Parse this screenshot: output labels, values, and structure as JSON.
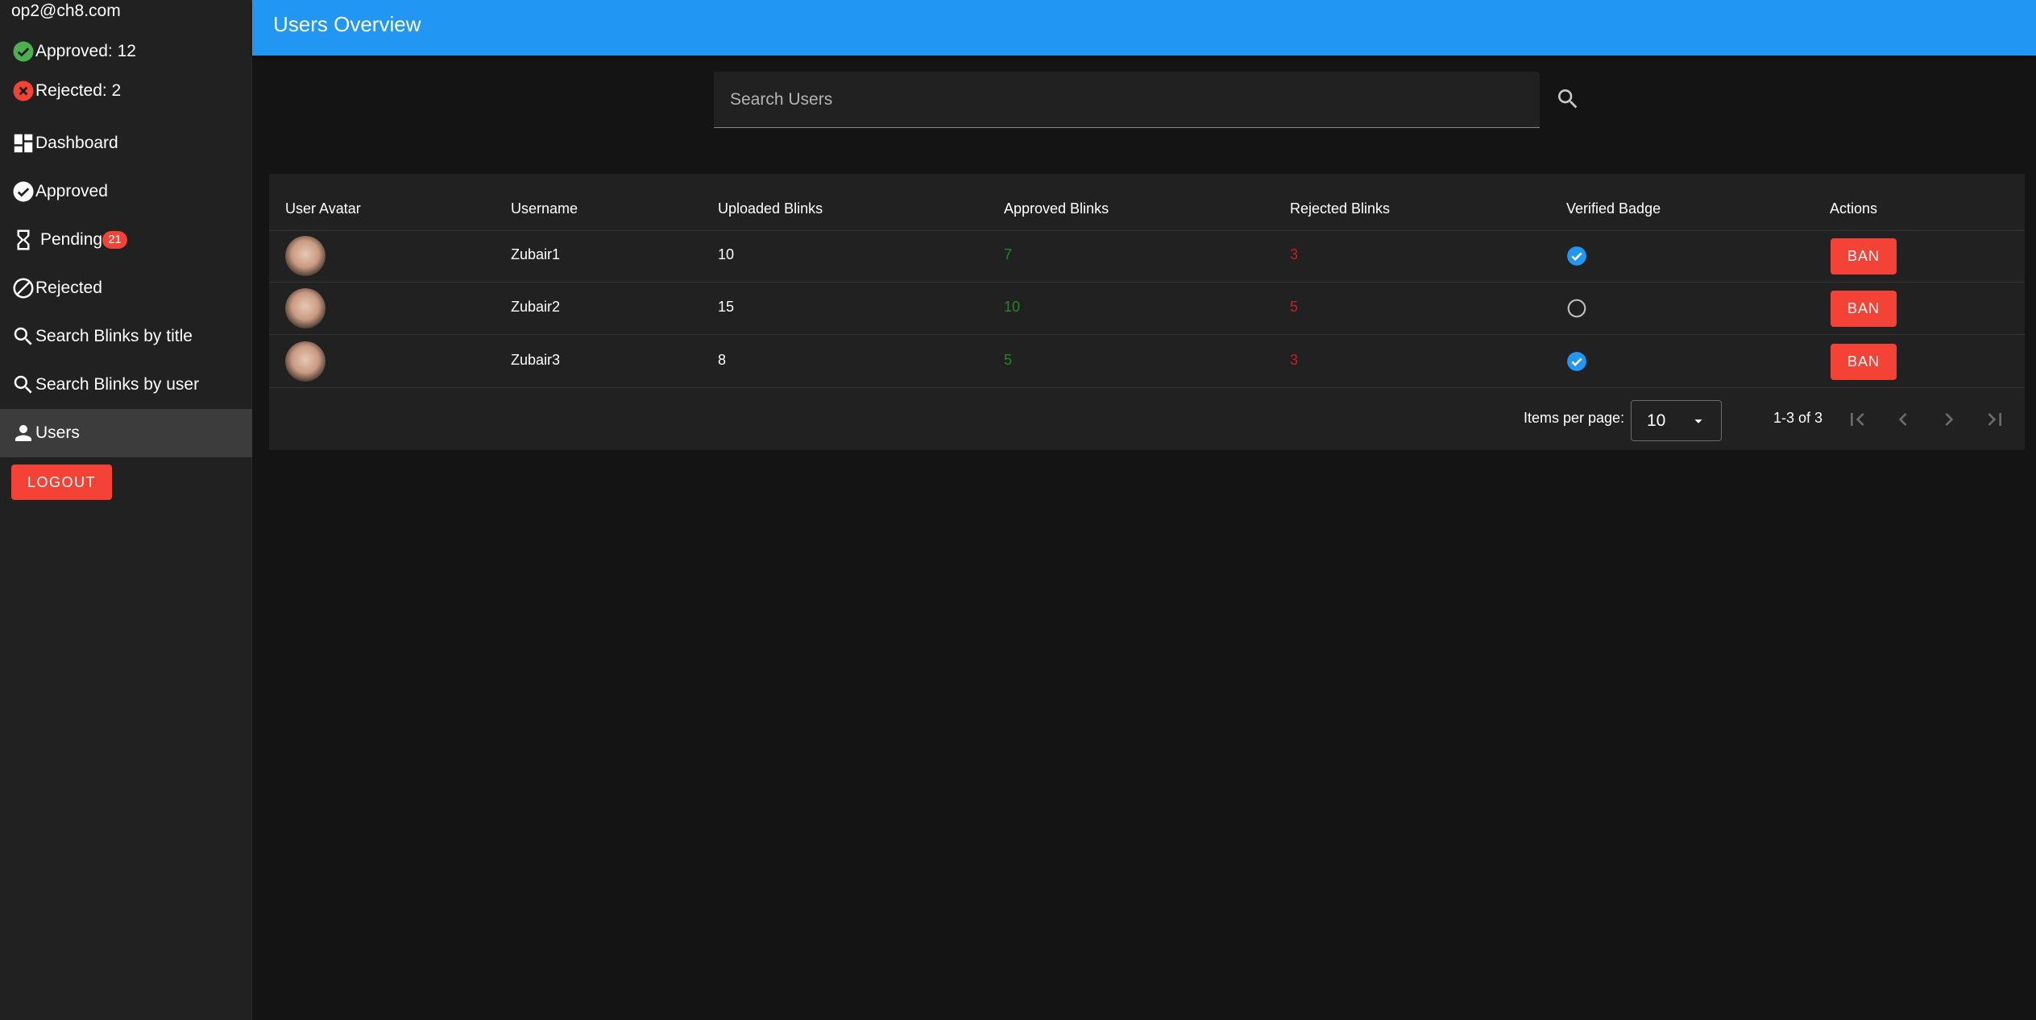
{
  "sidebar": {
    "email": "op2@ch8.com",
    "approved_stat": "Approved: 12",
    "rejected_stat": "Rejected: 2",
    "nav": {
      "dashboard": "Dashboard",
      "approved": "Approved",
      "pending": "Pending",
      "pending_count": "21",
      "rejected": "Rejected",
      "search_title": "Search Blinks by title",
      "search_user": "Search Blinks by user",
      "users": "Users"
    },
    "logout": "LOGOUT"
  },
  "header": {
    "title": "Users Overview"
  },
  "search": {
    "placeholder": "Search Users"
  },
  "table": {
    "headers": [
      "User Avatar",
      "Username",
      "Uploaded Blinks",
      "Approved Blinks",
      "Rejected Blinks",
      "Verified Badge",
      "Actions"
    ],
    "rows": [
      {
        "username": "Zubair1",
        "uploaded": "10",
        "approved": "7",
        "rejected": "3",
        "verified": true,
        "action": "BAN"
      },
      {
        "username": "Zubair2",
        "uploaded": "15",
        "approved": "10",
        "rejected": "5",
        "verified": false,
        "action": "BAN"
      },
      {
        "username": "Zubair3",
        "uploaded": "8",
        "approved": "5",
        "rejected": "3",
        "verified": true,
        "action": "BAN"
      }
    ]
  },
  "pagination": {
    "items_per_page_label": "Items per page:",
    "items_per_page": "10",
    "range": "1-3 of 3"
  },
  "colors": {
    "accent": "#2196f3",
    "danger": "#f44336",
    "approved_text": "#1e8a1e",
    "rejected_text": "#c62020",
    "verified": "#2196f3"
  }
}
